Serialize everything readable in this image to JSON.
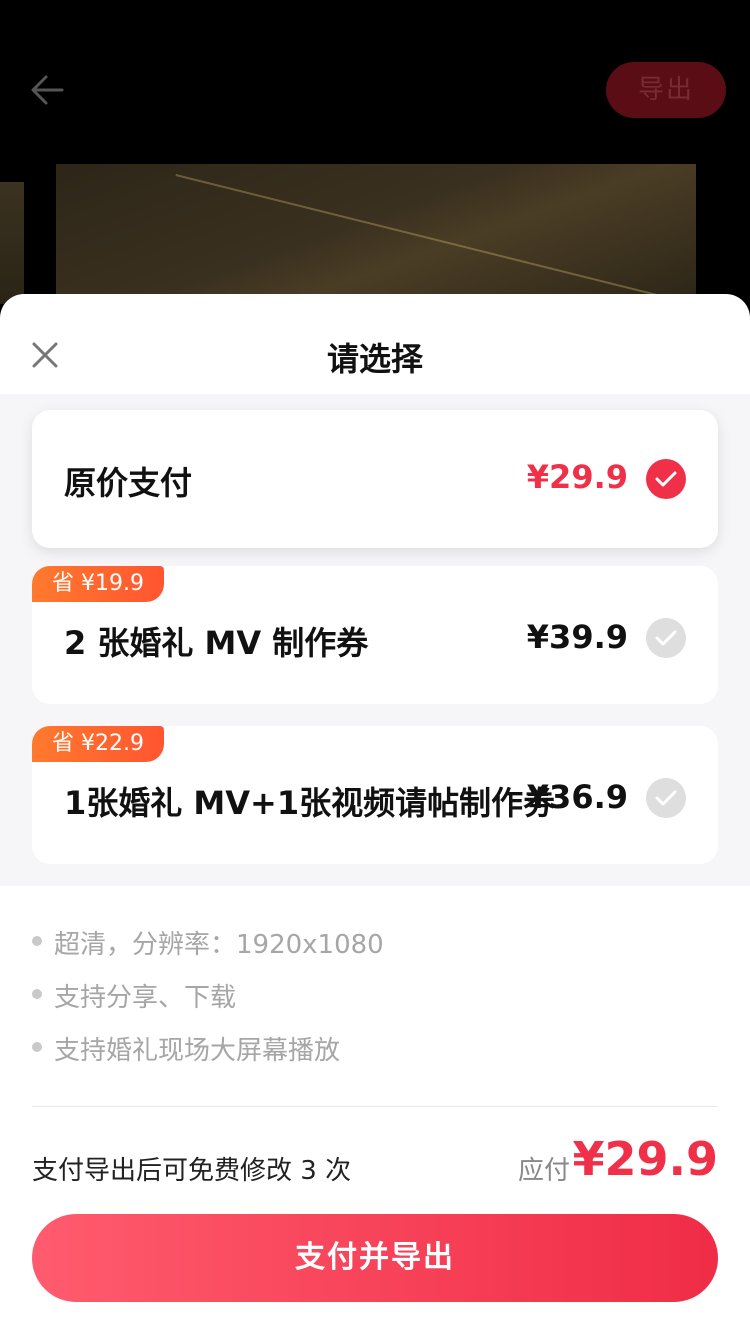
{
  "topbar": {
    "export_label": "导出"
  },
  "sheet": {
    "title": "请选择",
    "options": [
      {
        "label": "原价支付",
        "price": "¥29.9",
        "selected": true
      },
      {
        "badge": "省 ¥19.9",
        "label": "2 张婚礼 MV 制作券",
        "price": "¥39.9",
        "selected": false
      },
      {
        "badge": "省 ¥22.9",
        "label": "1张婚礼 MV+1张视频请帖制作券",
        "price": "¥36.9",
        "selected": false
      }
    ],
    "features": [
      "超清，分辨率：1920x1080",
      "支持分享、下载",
      "支持婚礼现场大屏幕播放"
    ],
    "edit_note": "支付导出后可免费修改 3 次",
    "pay_label": "应付",
    "pay_amount": "¥29.9",
    "pay_button": "支付并导出"
  },
  "colors": {
    "accent": "#f03049",
    "badge": "#ff6a2e"
  },
  "icons": {
    "back": "arrow-left-icon",
    "close": "close-icon",
    "check": "check-icon"
  }
}
